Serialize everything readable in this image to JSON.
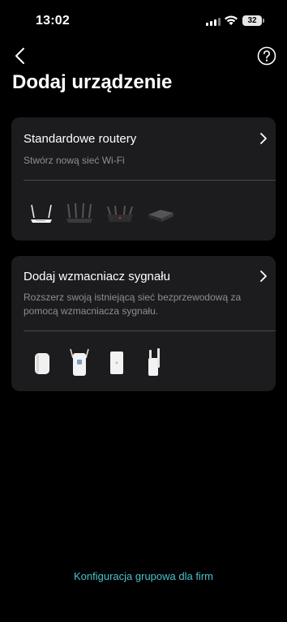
{
  "status_bar": {
    "time": "13:02",
    "battery": "32"
  },
  "header": {
    "title": "Dodaj urządzenie"
  },
  "cards": {
    "router": {
      "title": "Standardowe routery",
      "subtitle": "Stwórz nową sieć Wi-Fi",
      "device_icons": [
        "router-white-antennas-icon",
        "router-black-four-antennas-icon",
        "router-gaming-icon",
        "router-flat-box-icon"
      ]
    },
    "extender": {
      "title": "Dodaj wzmacniacz sygnału",
      "subtitle": "Rozszerz swoją istniejącą sieć bezprzewodową za pomocą wzmacniacza sygnału.",
      "device_icons": [
        "extender-compact-icon",
        "extender-dual-antenna-icon",
        "extender-slim-icon",
        "extender-tall-antenna-icon"
      ]
    }
  },
  "footer": {
    "link": "Konfiguracja grupowa dla firm"
  },
  "colors": {
    "background": "#000000",
    "card": "#1c1c1e",
    "accent": "#4ac2cf",
    "secondary_text": "#8e8e93"
  }
}
